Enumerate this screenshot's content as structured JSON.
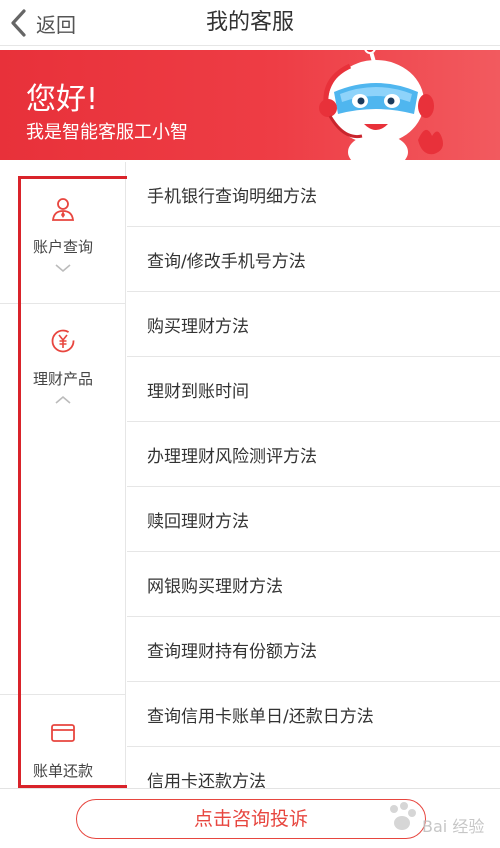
{
  "nav": {
    "back_label": "返回",
    "title": "我的客服"
  },
  "banner": {
    "greeting": "您好!",
    "subtitle": "我是智能客服工小智"
  },
  "categories": [
    {
      "label": "账户查询",
      "icon": "user-icon",
      "chevron": "down"
    },
    {
      "label": "理财产品",
      "icon": "yuan-icon",
      "chevron": "up"
    },
    {
      "label": "账单还款",
      "icon": "card-icon"
    }
  ],
  "items": [
    "手机银行查询明细方法",
    "查询/修改手机号方法",
    "购买理财方法",
    "理财到账时间",
    "办理理财风险测评方法",
    "赎回理财方法",
    "网银购买理财方法",
    "查询理财持有份额方法",
    "查询信用卡账单日/还款日方法",
    "信用卡还款方法"
  ],
  "bottom": {
    "complain_label": "点击咨询投诉"
  },
  "watermark": {
    "text": "Bai 经验"
  },
  "colors": {
    "brand_red": "#e8313a",
    "accent_red": "#e7463f",
    "highlight": "#d9232a"
  }
}
